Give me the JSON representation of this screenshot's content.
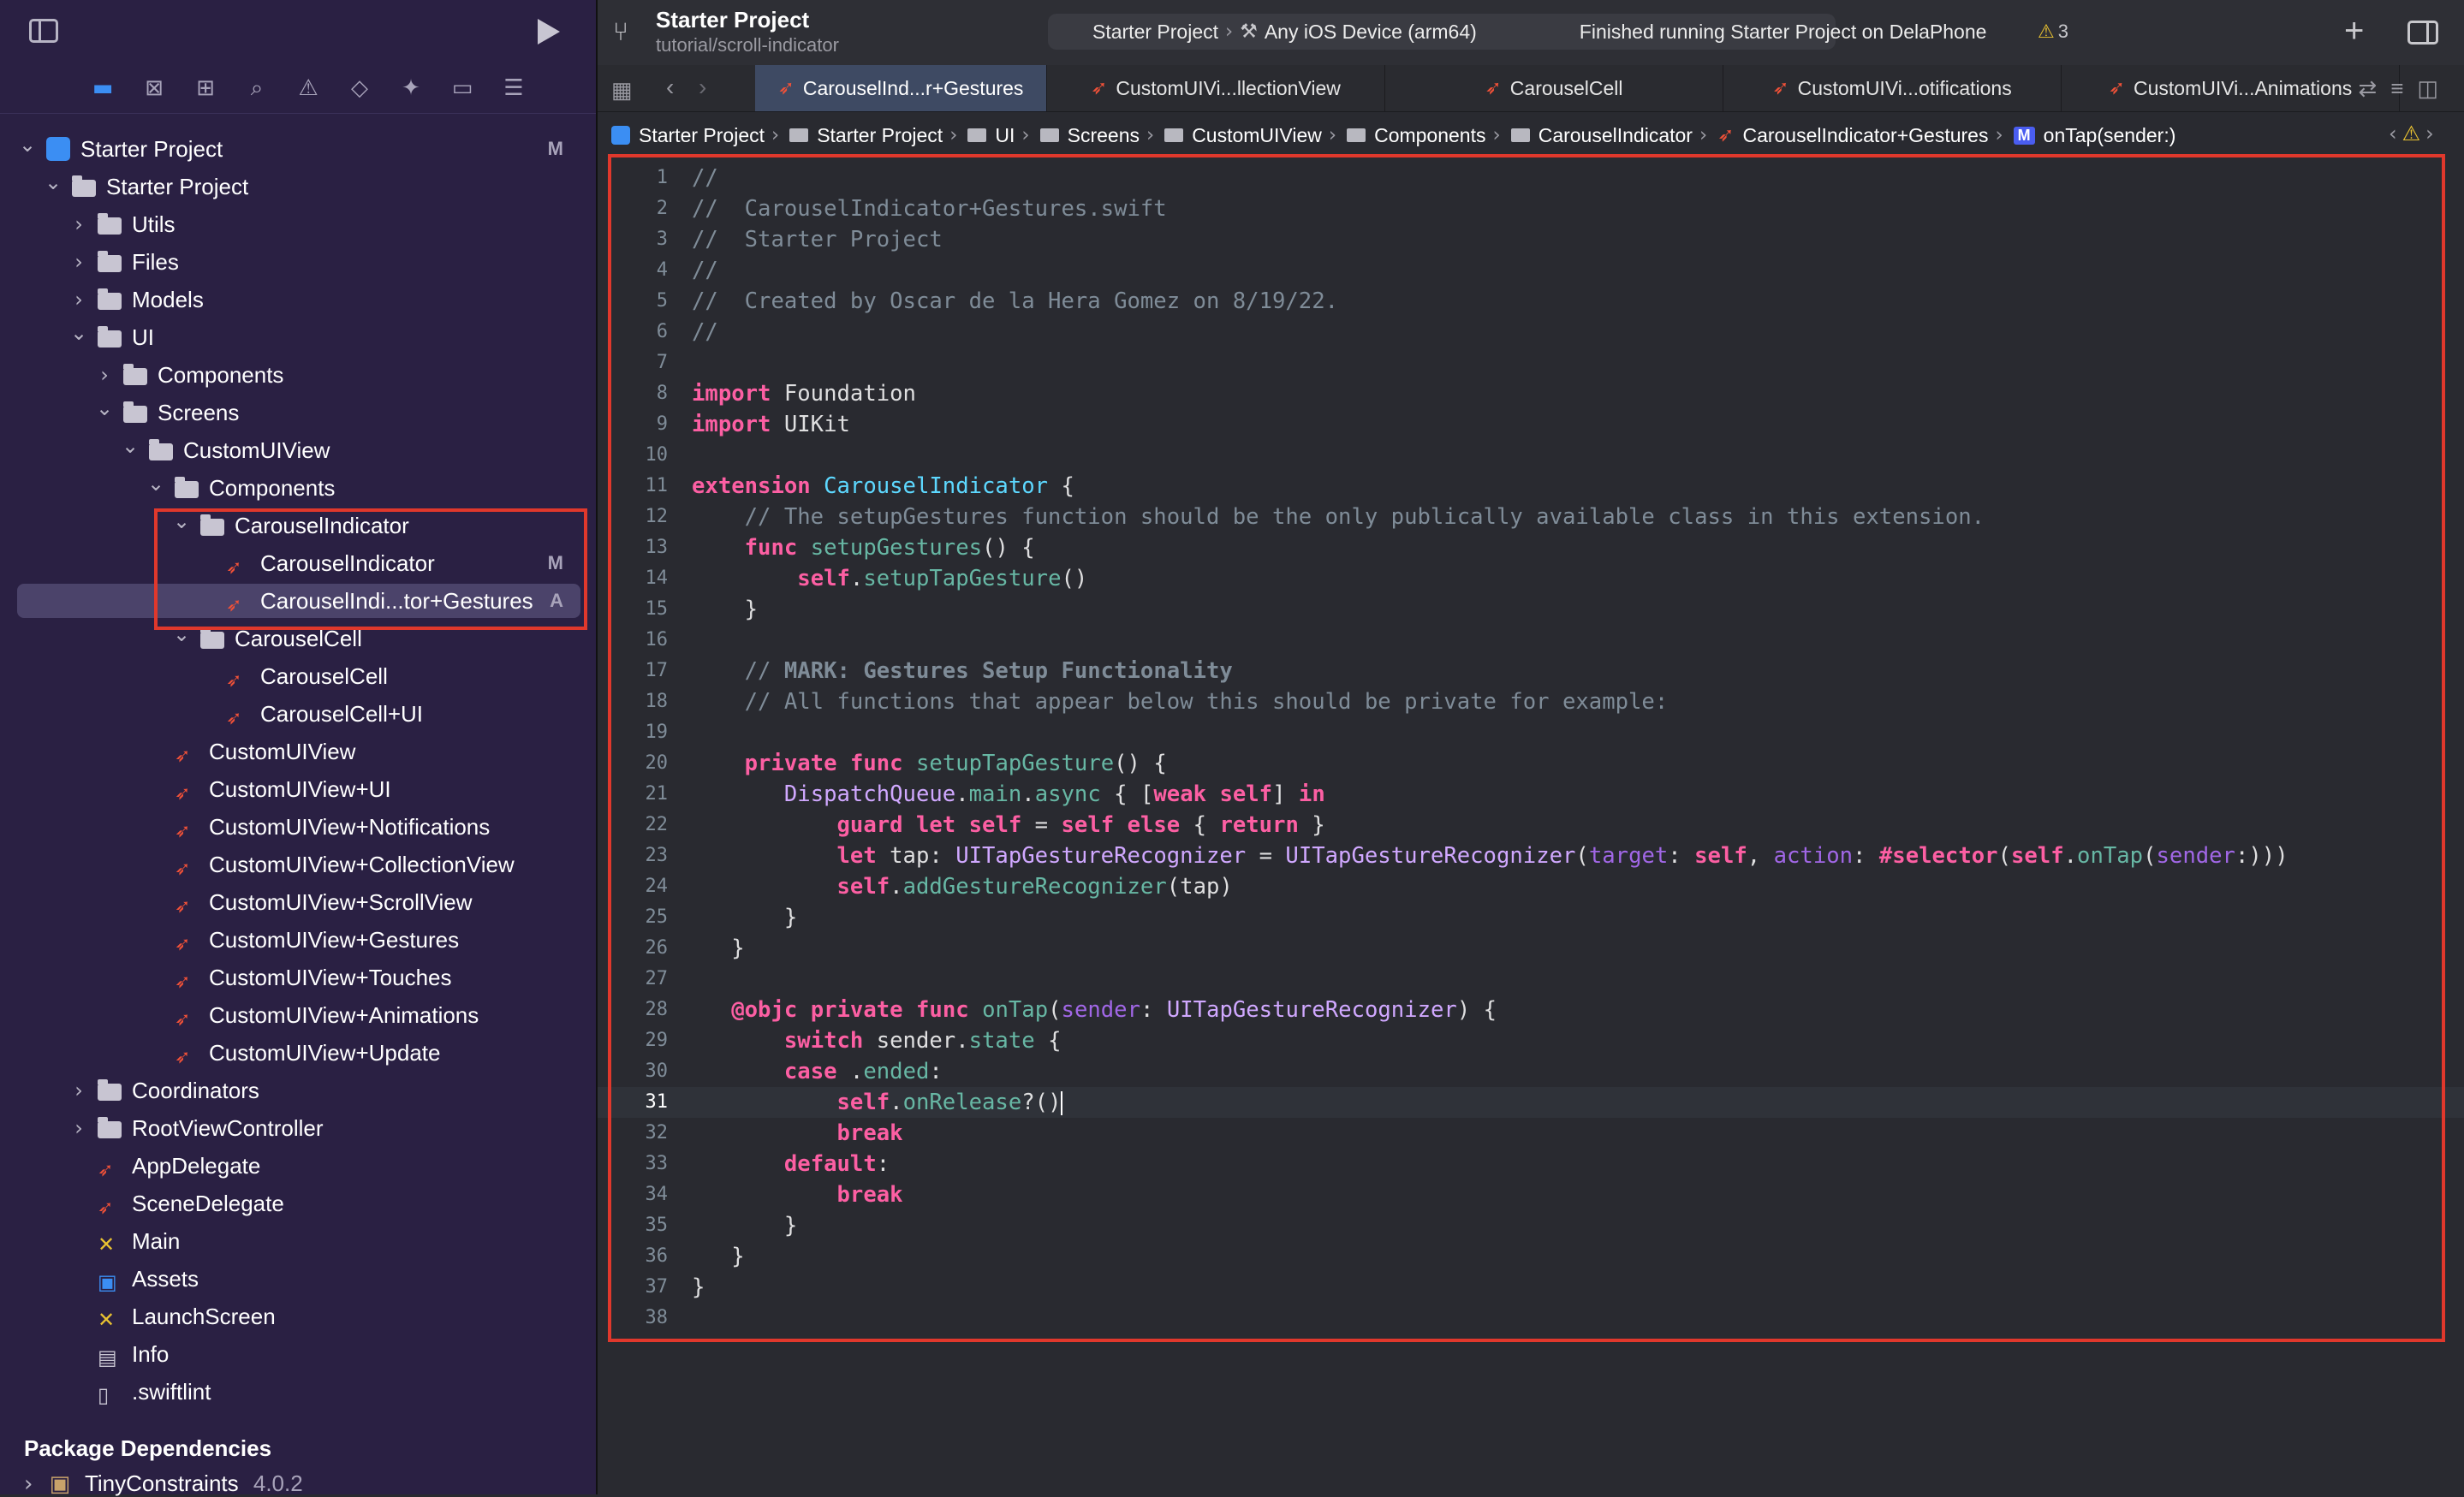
{
  "sidebar": {
    "nav_icons": [
      "folder-icon",
      "source-control-icon",
      "symbol-icon",
      "find-icon",
      "issue-icon",
      "test-icon",
      "debug-icon",
      "breakpoint-icon",
      "report-icon"
    ],
    "tree": [
      {
        "label": "Starter Project",
        "level": 0,
        "type": "project",
        "chevron": "open",
        "badge": "M"
      },
      {
        "label": "Starter Project",
        "level": 1,
        "type": "folder",
        "chevron": "open"
      },
      {
        "label": "Utils",
        "level": 2,
        "type": "folder",
        "chevron": "closed"
      },
      {
        "label": "Files",
        "level": 2,
        "type": "folder",
        "chevron": "closed"
      },
      {
        "label": "Models",
        "level": 2,
        "type": "folder",
        "chevron": "closed"
      },
      {
        "label": "UI",
        "level": 2,
        "type": "folder",
        "chevron": "open"
      },
      {
        "label": "Components",
        "level": 3,
        "type": "folder",
        "chevron": "closed"
      },
      {
        "label": "Screens",
        "level": 3,
        "type": "folder",
        "chevron": "open"
      },
      {
        "label": "CustomUIView",
        "level": 4,
        "type": "folder",
        "chevron": "open"
      },
      {
        "label": "Components",
        "level": 5,
        "type": "folder",
        "chevron": "open"
      },
      {
        "label": "CarouselIndicator",
        "level": 6,
        "type": "folder",
        "chevron": "open"
      },
      {
        "label": "CarouselIndicator",
        "level": 7,
        "type": "swift",
        "badge": "M"
      },
      {
        "label": "CarouselIndi...tor+Gestures",
        "level": 7,
        "type": "swift",
        "badge": "A",
        "selected": true
      },
      {
        "label": "CarouselCell",
        "level": 6,
        "type": "folder",
        "chevron": "open"
      },
      {
        "label": "CarouselCell",
        "level": 7,
        "type": "swift"
      },
      {
        "label": "CarouselCell+UI",
        "level": 7,
        "type": "swift"
      },
      {
        "label": "CustomUIView",
        "level": 5,
        "type": "swift"
      },
      {
        "label": "CustomUIView+UI",
        "level": 5,
        "type": "swift"
      },
      {
        "label": "CustomUIView+Notifications",
        "level": 5,
        "type": "swift"
      },
      {
        "label": "CustomUIView+CollectionView",
        "level": 5,
        "type": "swift"
      },
      {
        "label": "CustomUIView+ScrollView",
        "level": 5,
        "type": "swift"
      },
      {
        "label": "CustomUIView+Gestures",
        "level": 5,
        "type": "swift"
      },
      {
        "label": "CustomUIView+Touches",
        "level": 5,
        "type": "swift"
      },
      {
        "label": "CustomUIView+Animations",
        "level": 5,
        "type": "swift"
      },
      {
        "label": "CustomUIView+Update",
        "level": 5,
        "type": "swift"
      },
      {
        "label": "Coordinators",
        "level": 2,
        "type": "folder",
        "chevron": "closed"
      },
      {
        "label": "RootViewController",
        "level": 2,
        "type": "folder",
        "chevron": "closed"
      },
      {
        "label": "AppDelegate",
        "level": 2,
        "type": "swift"
      },
      {
        "label": "SceneDelegate",
        "level": 2,
        "type": "swift"
      },
      {
        "label": "Main",
        "level": 2,
        "type": "storyboard"
      },
      {
        "label": "Assets",
        "level": 2,
        "type": "assets"
      },
      {
        "label": "LaunchScreen",
        "level": 2,
        "type": "storyboard"
      },
      {
        "label": "Info",
        "level": 2,
        "type": "plist"
      },
      {
        "label": ".swiftlint",
        "level": 2,
        "type": "text"
      }
    ],
    "package_title": "Package Dependencies",
    "package_name": "TinyConstraints",
    "package_version": "4.0.2"
  },
  "toolbar": {
    "project_title": "Starter Project",
    "branch": "tutorial/scroll-indicator",
    "scheme_app": "Starter Project",
    "scheme_device": "Any iOS Device (arm64)",
    "status": "Finished running Starter Project on DelaPhone",
    "warning_count": "3"
  },
  "tabs": [
    {
      "label": "CarouselInd...r+Gestures",
      "active": true
    },
    {
      "label": "CustomUIVi...llectionView"
    },
    {
      "label": "CarouselCell"
    },
    {
      "label": "CustomUIVi...otifications"
    },
    {
      "label": "CustomUIVi...Animations"
    }
  ],
  "breadcrumb": [
    {
      "label": "Starter Project",
      "icon": "project"
    },
    {
      "label": "Starter Project",
      "icon": "folder"
    },
    {
      "label": "UI",
      "icon": "folder"
    },
    {
      "label": "Screens",
      "icon": "folder"
    },
    {
      "label": "CustomUIView",
      "icon": "folder"
    },
    {
      "label": "Components",
      "icon": "folder"
    },
    {
      "label": "CarouselIndicator",
      "icon": "folder"
    },
    {
      "label": "CarouselIndicator+Gestures",
      "icon": "swift"
    },
    {
      "label": "onTap(sender:)",
      "icon": "method",
      "method_badge": "M"
    }
  ],
  "editor": {
    "current_line": 31,
    "lines": [
      "//",
      "//  CarouselIndicator+Gestures.swift",
      "//  Starter Project",
      "//",
      "//  Created by Oscar de la Hera Gomez on 8/19/22.",
      "//",
      "",
      "import Foundation",
      "import UIKit",
      "",
      "extension CarouselIndicator {",
      "    // The setupGestures function should be the only publically available class in this extension.",
      "    func setupGestures() {",
      "        self.setupTapGesture()",
      "    }",
      "",
      "    // MARK: Gestures Setup Functionality",
      "    // All functions that appear below this should be private for example:",
      "",
      "    private func setupTapGesture() {",
      "       DispatchQueue.main.async { [weak self] in",
      "           guard let self = self else { return }",
      "           let tap: UITapGestureRecognizer = UITapGestureRecognizer(target: self, action: #selector(self.onTap(sender:)))",
      "           self.addGestureRecognizer(tap)",
      "       }",
      "   }",
      "",
      "   @objc private func onTap(sender: UITapGestureRecognizer) {",
      "       switch sender.state {",
      "       case .ended:",
      "           self.onRelease?()",
      "           break",
      "       default:",
      "           break",
      "       }",
      "   }",
      "}",
      ""
    ]
  },
  "colors": {
    "sidebar_bg": "#2a2043",
    "editor_bg": "#292a30",
    "highlight_red": "#e0382c",
    "swift_orange": "#f05138",
    "keyword_pink": "#fc5fa3"
  }
}
